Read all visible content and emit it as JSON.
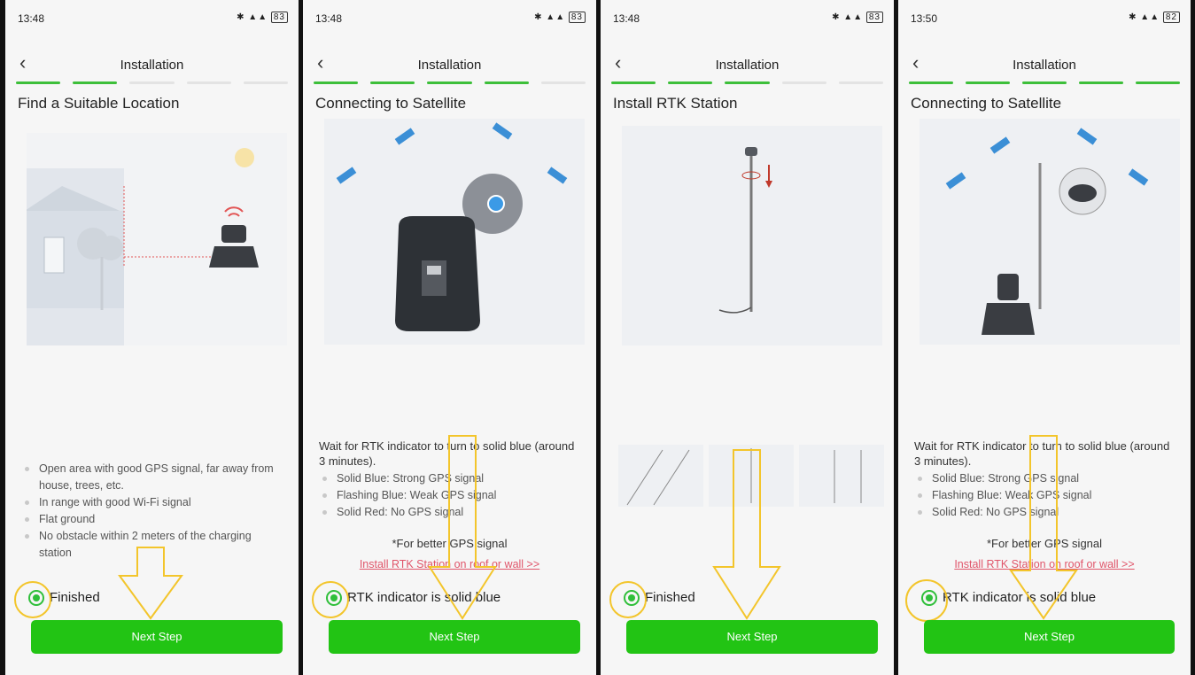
{
  "screens": [
    {
      "time": "13:48",
      "battery": "83",
      "nav_title": "Installation",
      "heading": "Find a Suitable Location",
      "intro": "",
      "bullets": [
        "Open area with good GPS signal, far away from house, trees, etc.",
        "In range with good Wi-Fi signal",
        "Flat ground",
        "No obstacle within 2 meters of the charging station"
      ],
      "note": "",
      "link": "",
      "checkbox_label": "Finished",
      "button_label": "Next Step",
      "progress_complete": 2,
      "progress_total": 5
    },
    {
      "time": "13:48",
      "battery": "83",
      "nav_title": "Installation",
      "heading": "Connecting to Satellite",
      "intro": "Wait for RTK indicator to turn to solid blue (around 3 minutes).",
      "bullets": [
        "Solid Blue: Strong GPS signal",
        "Flashing Blue: Weak GPS signal",
        "Solid Red: No GPS signal"
      ],
      "note": "*For better GPS signal",
      "link": "Install RTK Station on roof or wall >>",
      "checkbox_label": "RTK indicator is solid blue",
      "button_label": "Next Step",
      "progress_complete": 4,
      "progress_total": 5
    },
    {
      "time": "13:48",
      "battery": "83",
      "nav_title": "Installation",
      "heading": "Install RTK Station",
      "intro": "",
      "bullets": [],
      "note": "",
      "link": "",
      "checkbox_label": "Finished",
      "button_label": "Next Step",
      "progress_complete": 3,
      "progress_total": 5
    },
    {
      "time": "13:50",
      "battery": "82",
      "nav_title": "Installation",
      "heading": "Connecting to Satellite",
      "intro": "Wait for RTK indicator to turn to solid blue (around 3 minutes).",
      "bullets": [
        "Solid Blue: Strong GPS signal",
        "Flashing Blue: Weak GPS signal",
        "Solid Red: No GPS signal"
      ],
      "note": "*For better GPS signal",
      "link": "Install RTK Station on roof or wall >>",
      "checkbox_label": "RTK indicator is solid blue",
      "button_label": "Next Step",
      "progress_complete": 5,
      "progress_total": 5
    }
  ],
  "colors": {
    "accent_green": "#22c414",
    "progress_green": "#3dbf3a",
    "link_red": "#e0556a",
    "annotation_yellow": "#f3c52b",
    "satellite_blue": "#3b8fd6"
  },
  "icons": {
    "back": "chevron-left-icon",
    "alarm": "alarm-icon",
    "bluetooth": "bluetooth-icon",
    "signal": "signal-icon",
    "battery": "battery-icon"
  }
}
